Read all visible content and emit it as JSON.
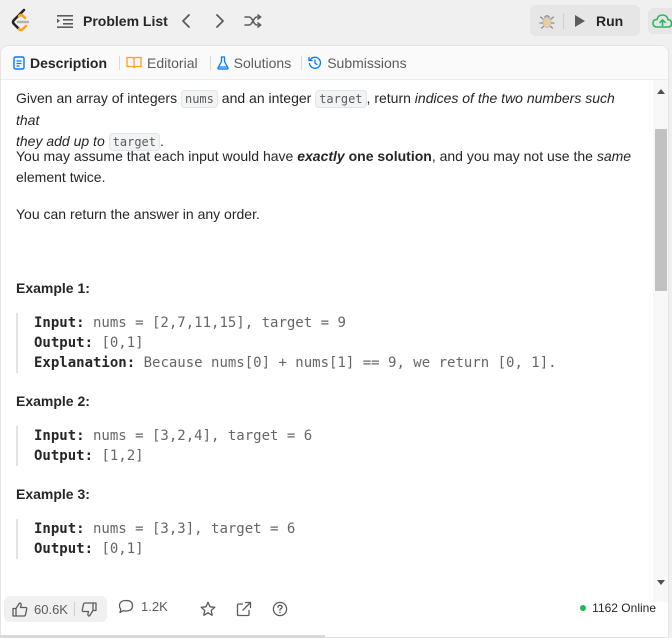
{
  "header": {
    "problem_list_label": "Problem List",
    "run_label": "Run",
    "colors": {
      "logo_orange": "#ffa116",
      "logo_dark": "#262626",
      "upload_green": "#2db55d"
    }
  },
  "tabs": [
    {
      "label": "Description",
      "icon": "description-icon",
      "icon_color": "#007aff"
    },
    {
      "label": "Editorial",
      "icon": "book-icon",
      "icon_color": "#ffa116"
    },
    {
      "label": "Solutions",
      "icon": "flask-icon",
      "icon_color": "#007aff"
    },
    {
      "label": "Submissions",
      "icon": "history-icon",
      "icon_color": "#007aff"
    }
  ],
  "description": {
    "p1_a": "Given an array of integers ",
    "p1_code1": "nums",
    "p1_b": " and an integer ",
    "p1_code2": "target",
    "p1_c": ", return ",
    "p1_em1": "indices of the two numbers such that",
    "p1_em2": "they add up to",
    "p1_code3": "target",
    "p1_end": ".",
    "p2_a": "You may assume that each input would have ",
    "p2_strong_em": "exactly",
    "p2_strong": " one solution",
    "p2_b": ", and you may not use the ",
    "p2_em": "same",
    "p2_c": "element twice.",
    "p3": "You can return the answer in any order."
  },
  "examples": [
    {
      "title": "Example 1:",
      "input_key": "Input:",
      "input": " nums = [2,7,11,15], target = 9",
      "output_key": "Output:",
      "output": " [0,1]",
      "explanation_key": "Explanation:",
      "explanation": " Because nums[0] + nums[1] == 9, we return [0, 1]."
    },
    {
      "title": "Example 2:",
      "input_key": "Input:",
      "input": " nums = [3,2,4], target = 6",
      "output_key": "Output:",
      "output": " [1,2]"
    },
    {
      "title": "Example 3:",
      "input_key": "Input:",
      "input": " nums = [3,3], target = 6",
      "output_key": "Output:",
      "output": " [0,1]"
    }
  ],
  "footer": {
    "likes": "60.6K",
    "comments": "1.2K",
    "online": "1162 Online",
    "online_color": "#1db954"
  }
}
